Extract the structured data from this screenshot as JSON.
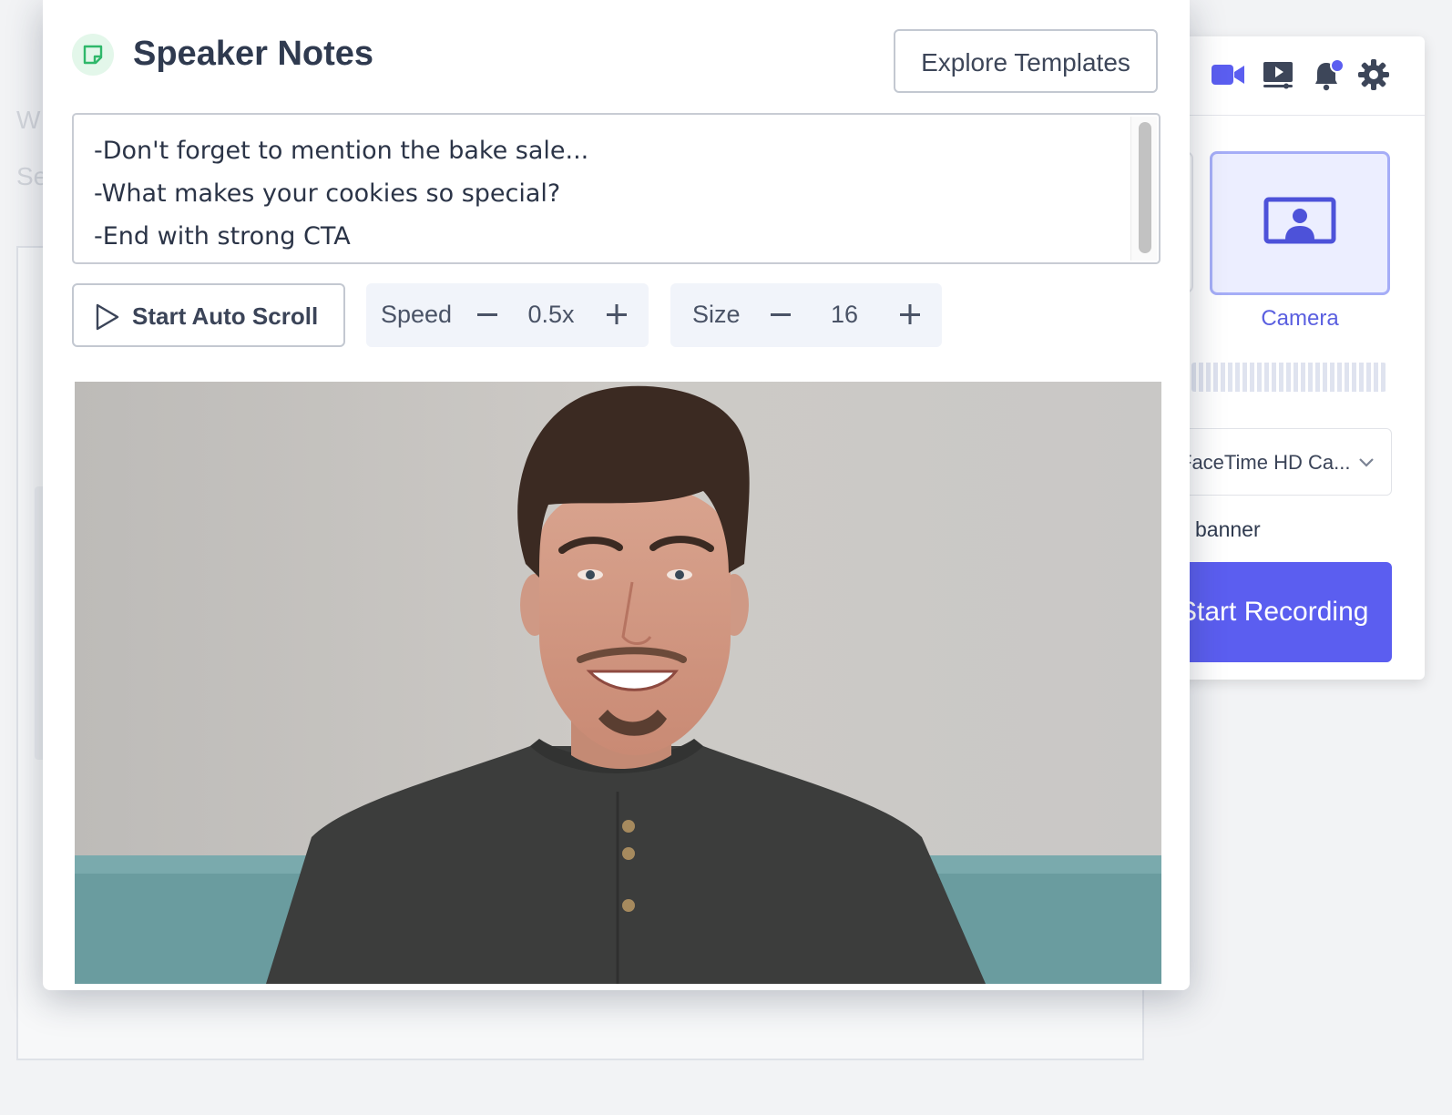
{
  "background": {
    "faded_text_1": "W",
    "faded_text_2": "Se"
  },
  "recorder_panel": {
    "icons": [
      "video-camera-icon",
      "screen-share-icon",
      "notification-bell-icon",
      "settings-gear-icon"
    ],
    "selected_source_label": "Camera",
    "camera_select_value": "FaceTime HD Ca...",
    "banner_label": "banner",
    "start_button_label": "Start Recording",
    "accent_color": "#5b5ef0"
  },
  "modal": {
    "title": "Speaker Notes",
    "explore_button": "Explore Templates",
    "notes_lines": [
      "-Don't forget to mention the bake sale...",
      "-What makes your cookies so special?",
      "-End with strong CTA"
    ],
    "auto_scroll_button": "Start Auto Scroll",
    "speed": {
      "label": "Speed",
      "value": "0.5x"
    },
    "size": {
      "label": "Size",
      "value": "16"
    }
  }
}
